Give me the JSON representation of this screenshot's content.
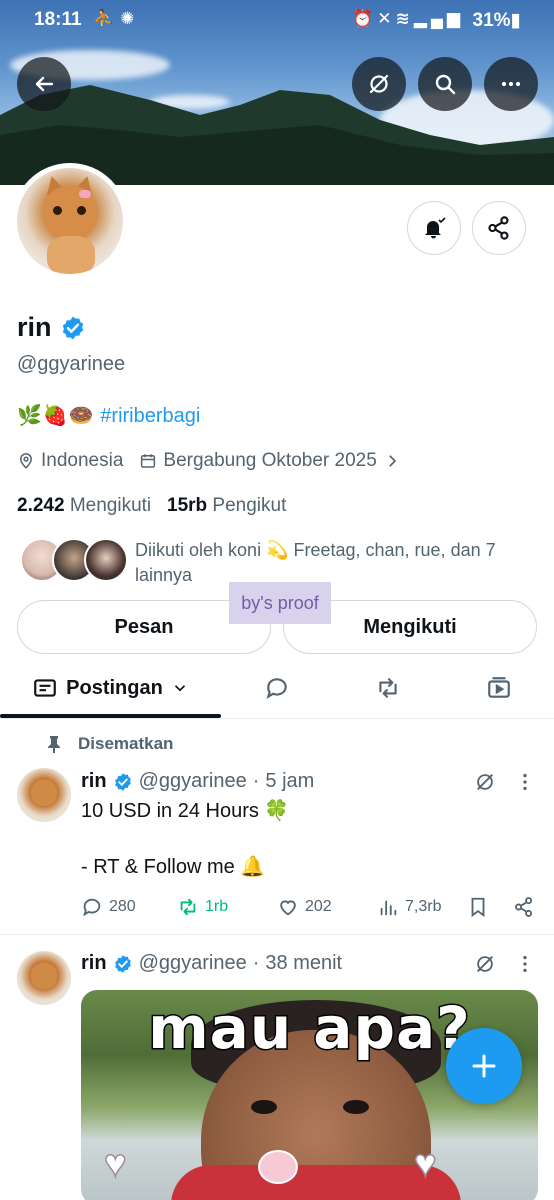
{
  "status_bar": {
    "time": "18:11",
    "left_icons": [
      "person-upload-icon",
      "aperture-icon"
    ],
    "right_icons": [
      "alarm-icon",
      "mute-icon",
      "wifi-icon",
      "signal-icon"
    ],
    "battery": "31%"
  },
  "profile": {
    "name": "rin",
    "handle": "@ggyarinee",
    "bio_emojis": "🌿🍓🍩",
    "bio_hashtag": "#ririberbagi",
    "location": "Indonesia",
    "joined": "Bergabung Oktober 2025",
    "following_count": "2.242",
    "following_label": "Mengikuti",
    "followers_count": "15rb",
    "followers_label": "Pengikut",
    "followed_by": "Diikuti oleh koni 💫 Freetag, chan, rue, dan 7 lainnya"
  },
  "overlay_label": "by's proof",
  "buttons": {
    "message": "Pesan",
    "following": "Mengikuti"
  },
  "tabs": {
    "posts": "Postingan"
  },
  "pinned_label": "Disematkan",
  "posts": [
    {
      "name": "rin",
      "handle": "@ggyarinee",
      "time": "5 jam",
      "text": "10 USD in 24 Hours 🍀\n\n- RT & Follow me 🔔",
      "replies": "280",
      "reposts": "1rb",
      "likes": "202",
      "views": "7,3rb"
    },
    {
      "name": "rin",
      "handle": "@ggyarinee",
      "time": "38 menit",
      "media_text": "mau apa?"
    }
  ],
  "colors": {
    "accent": "#1d9bf0",
    "repost_green": "#00ba7c",
    "muted": "#536471"
  }
}
